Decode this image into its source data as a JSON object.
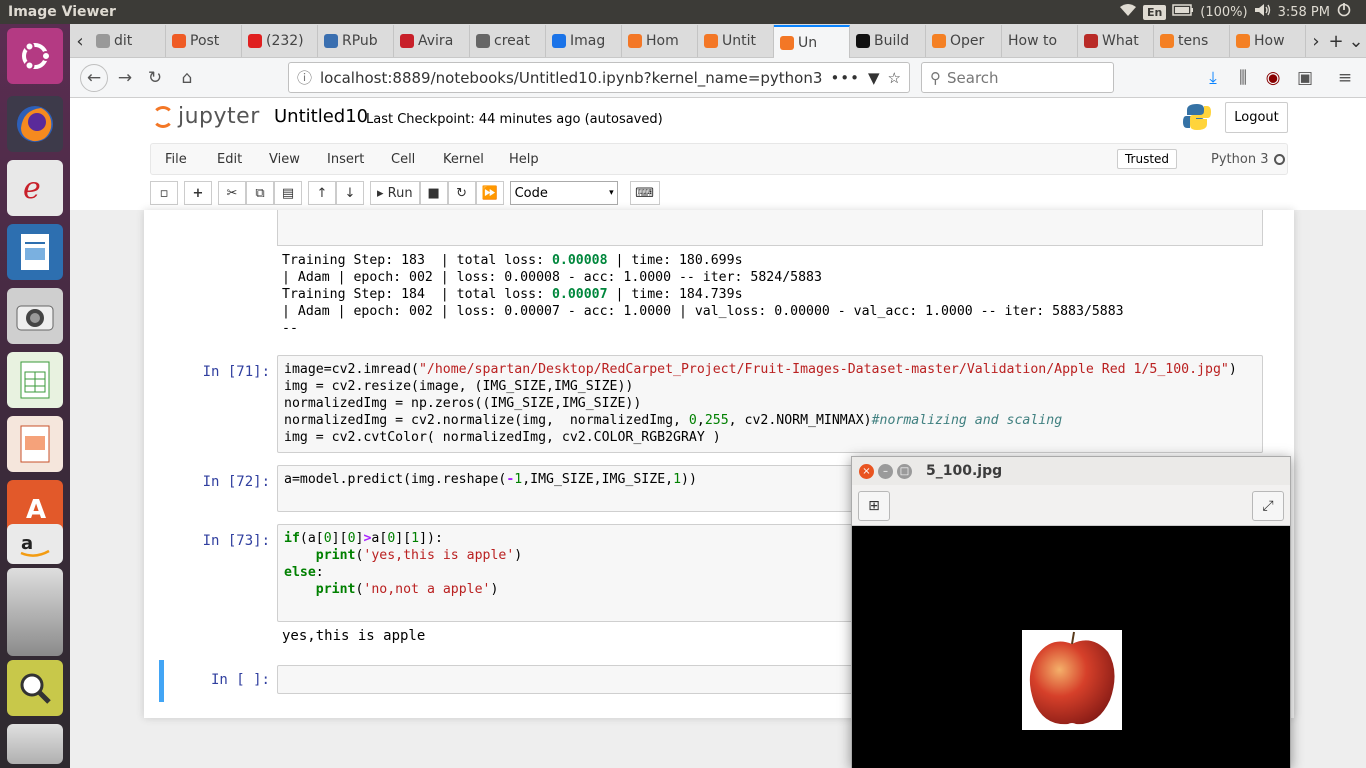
{
  "topbar": {
    "app_name": "Image Viewer",
    "keyboard": "En",
    "battery": "(100%)",
    "time": "3:58 PM"
  },
  "launcher": {
    "icons": [
      "ubuntu-logo-icon",
      "firefox-icon",
      "evince-icon",
      "text-editor-icon",
      "camera-icon",
      "spreadsheet-icon",
      "presentation-icon",
      "software-center-icon",
      "amazon-icon",
      "image-viewer-icon"
    ]
  },
  "browser": {
    "tabs": [
      {
        "label": "dit",
        "favicon": "generic"
      },
      {
        "label": "Post",
        "favicon": "postman"
      },
      {
        "label": "(232)",
        "favicon": "youtube"
      },
      {
        "label": "RPub",
        "favicon": "rpubs"
      },
      {
        "label": "Avira",
        "favicon": "gmail"
      },
      {
        "label": "creat",
        "favicon": "doc"
      },
      {
        "label": "Imag",
        "favicon": "dot"
      },
      {
        "label": "Hom",
        "favicon": "jupyter"
      },
      {
        "label": "Untit",
        "favicon": "jupyter"
      },
      {
        "label": "Un",
        "favicon": "jupyter-active"
      },
      {
        "label": "Build",
        "favicon": "medium"
      },
      {
        "label": "Oper",
        "favicon": "stackoverflow"
      },
      {
        "label": "How to",
        "favicon": "none"
      },
      {
        "label": "What",
        "favicon": "quora"
      },
      {
        "label": "tens",
        "favicon": "stackoverflow"
      },
      {
        "label": "How",
        "favicon": "stackoverflow"
      }
    ],
    "url": "localhost:8889/notebooks/Untitled10.ipynb?kernel_name=python3",
    "search_placeholder": "Search"
  },
  "jupyter": {
    "logo_text": "jupyter",
    "notebook_name": "Untitled10",
    "checkpoint": "Last Checkpoint: 44 minutes ago",
    "autosave": "(autosaved)",
    "logout": "Logout",
    "menu": [
      "File",
      "Edit",
      "View",
      "Insert",
      "Cell",
      "Kernel",
      "Help"
    ],
    "trusted": "Trusted",
    "kernel_name": "Python 3",
    "run_label": "Run",
    "cell_type": "Code"
  },
  "cells": {
    "output_prev": [
      [
        "Training Step: 183  | total loss: ",
        "0.00008",
        " | time: 180.699s"
      ],
      [
        "| Adam | epoch: 002 | loss: 0.00008 - acc: 1.0000 -- iter: 5824/5883",
        "",
        ""
      ],
      [
        "Training Step: 184  | total loss: ",
        "0.00007",
        " | time: 184.739s"
      ],
      [
        "| Adam | epoch: 002 | loss: 0.00007 - acc: 1.0000 | val_loss: 0.00000 - val_acc: 1.0000 -- iter: 5883/5883",
        "",
        ""
      ],
      [
        "--",
        "",
        ""
      ]
    ],
    "c71_prompt": "In [71]:",
    "c71_path": "\"/home/spartan/Desktop/RedCarpet_Project/Fruit-Images-Dataset-master/Validation/Apple Red 1/5_100.jpg\"",
    "c71_line2": "img = cv2.resize(image, (IMG_SIZE,IMG_SIZE))",
    "c71_line3": "normalizedImg = np.zeros((IMG_SIZE,IMG_SIZE))",
    "c71_comment": "#normalizing and scaling",
    "c71_line5": "img = cv2.cvtColor( normalizedImg, cv2.COLOR_RGB2GRAY )",
    "c72_prompt": "In [72]:",
    "c73_prompt": "In [73]:",
    "c73_str1": "'yes,this is apple'",
    "c73_str2": "'no,not a apple'",
    "c73_output": "yes,this is apple",
    "empty_prompt": "In [ ]:"
  },
  "viewer": {
    "title": "5_100.jpg"
  }
}
